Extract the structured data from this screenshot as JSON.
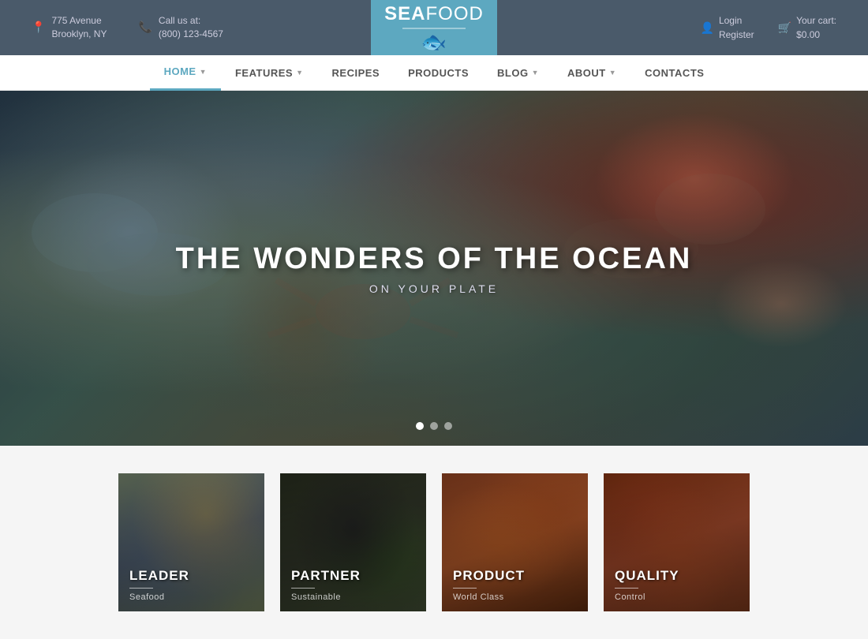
{
  "topbar": {
    "address_label": "775 Avenue\nBrooklyn, NY",
    "phone_label": "Call us at:\n(800) 123-4567",
    "login_label": "Login",
    "register_label": "Register",
    "cart_label": "Your cart:",
    "cart_amount": "$0.00"
  },
  "logo": {
    "sea": "SEA",
    "food": "FOOD",
    "fish": "🐟"
  },
  "nav": {
    "items": [
      {
        "label": "HOME",
        "has_arrow": true,
        "active": true
      },
      {
        "label": "FEATURES",
        "has_arrow": true,
        "active": false
      },
      {
        "label": "RECIPES",
        "has_arrow": false,
        "active": false
      },
      {
        "label": "PRODUCTS",
        "has_arrow": false,
        "active": false
      },
      {
        "label": "BLOG",
        "has_arrow": true,
        "active": false
      },
      {
        "label": "ABOUT",
        "has_arrow": true,
        "active": false
      },
      {
        "label": "CONTACTS",
        "has_arrow": false,
        "active": false
      }
    ]
  },
  "hero": {
    "title": "THE WONDERS OF THE OCEAN",
    "subtitle": "ON YOUR PLATE",
    "dots": [
      {
        "active": true
      },
      {
        "active": false
      },
      {
        "active": false
      }
    ]
  },
  "cards": [
    {
      "title": "LEADER",
      "subtitle": "Seafood",
      "bg_class": "card-bg-1"
    },
    {
      "title": "PARTNER",
      "subtitle": "Sustainable",
      "bg_class": "card-bg-2"
    },
    {
      "title": "PRODUCT",
      "subtitle": "World Class",
      "bg_class": "card-bg-3"
    },
    {
      "title": "QUALITY",
      "subtitle": "Control",
      "bg_class": "card-bg-4"
    }
  ]
}
